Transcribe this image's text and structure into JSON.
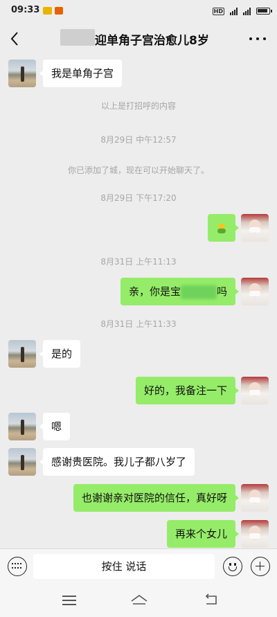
{
  "statusbar": {
    "time": "09:33",
    "hd": "HD",
    "net1": "4G",
    "net2": "4G"
  },
  "header": {
    "title": "迎单角子宫治愈儿8岁"
  },
  "messages": [
    {
      "type": "left",
      "text": "我是单角子宫"
    },
    {
      "type": "system",
      "text": "以上是打招呼的内容"
    },
    {
      "type": "time",
      "text": "8月29日  中午12:57"
    },
    {
      "type": "system",
      "text": "你已添加了城，现在可以开始聊天了。"
    },
    {
      "type": "time",
      "text": "8月29日  下午17:20"
    },
    {
      "type": "right",
      "text": "",
      "emoji": "bear-emoji"
    },
    {
      "type": "time",
      "text": "8月31日  上午11:13"
    },
    {
      "type": "right",
      "text_a": "亲，你是宝",
      "text_b": "吗"
    },
    {
      "type": "time",
      "text": "8月31日  上午11:33"
    },
    {
      "type": "left",
      "text": "是的"
    },
    {
      "type": "right",
      "text": "好的，我备注一下"
    },
    {
      "type": "left",
      "text": "嗯"
    },
    {
      "type": "left",
      "text": "感谢贵医院。我儿子都八岁了"
    },
    {
      "type": "right",
      "text": "也谢谢亲对医院的信任，真好呀"
    },
    {
      "type": "right",
      "text": "再来个女儿"
    }
  ],
  "input": {
    "hold_to_talk": "按住 说话"
  },
  "colors": {
    "background": "#ededed",
    "bubble_self": "#95ec69",
    "bubble_other": "#ffffff"
  }
}
